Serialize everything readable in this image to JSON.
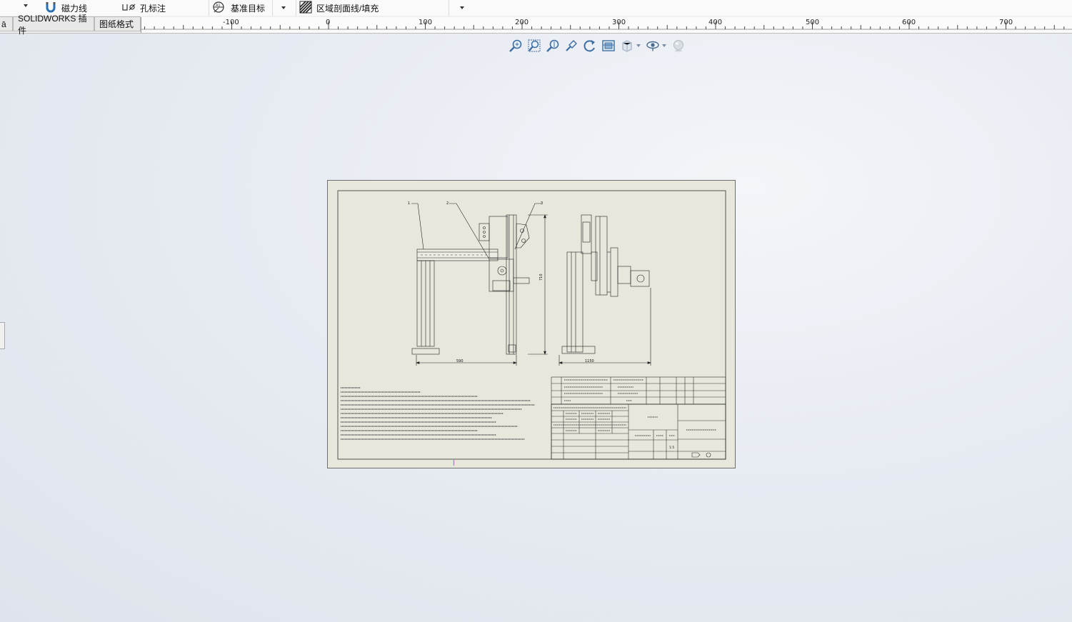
{
  "toolbar": {
    "magnet_line": "磁力线",
    "hole_callout": "孔标注",
    "datum_target": "基准目标",
    "area_hatch": "区域剖面线/填充"
  },
  "tabs": {
    "partial_left": "ā",
    "addins": "SOLIDWORKS 插件",
    "sheet_format": "图纸格式"
  },
  "ruler": {
    "labels": [
      "-100",
      "0",
      "100",
      "200",
      "300",
      "400",
      "500",
      "600",
      "700"
    ]
  },
  "view_toolbar": {
    "icons": [
      "zoom-to-fit-icon",
      "zoom-to-area-icon",
      "zoom-in-out-icon",
      "zoom-to-selection-icon",
      "rotate-icon",
      "view-orientation-icon",
      "display-style-icon",
      "hide-show-items-icon",
      "apply-scene-icon"
    ]
  },
  "drawing": {
    "dim_width": "590",
    "dim_height": "710",
    "dim_side_width": "1150",
    "balloons": [
      "1",
      "2",
      "3"
    ],
    "title_block": {
      "scale": "1:5"
    }
  }
}
